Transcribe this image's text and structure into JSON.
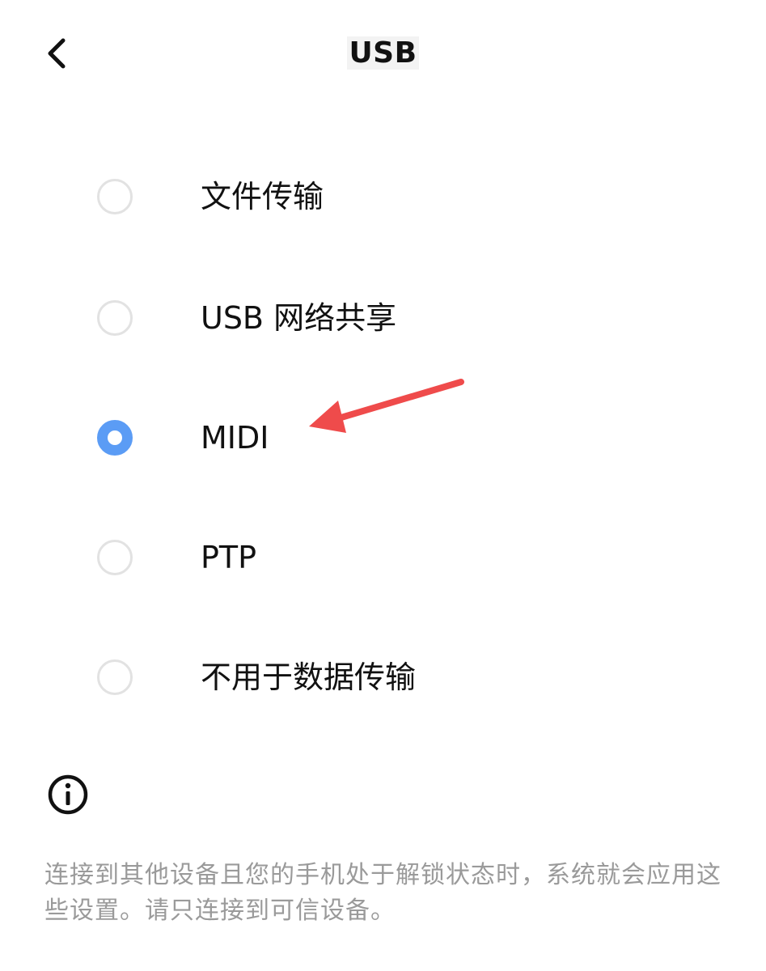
{
  "header": {
    "title": "USB",
    "back_icon": "chevron-left-icon"
  },
  "options": [
    {
      "label": "文件传输",
      "selected": false
    },
    {
      "label": "USB 网络共享",
      "selected": false
    },
    {
      "label": "MIDI",
      "selected": true
    },
    {
      "label": "PTP",
      "selected": false
    },
    {
      "label": "不用于数据传输",
      "selected": false
    }
  ],
  "info": {
    "icon": "info-icon",
    "text": "连接到其他设备且您的手机处于解锁状态时，系统就会应用这些设置。请只连接到可信设备。"
  },
  "colors": {
    "accent": "#5b9cf5",
    "annotation_arrow": "#ef4b4b",
    "radio_unchecked_border": "#e2e2e2",
    "footer_text": "#9a9a9a"
  }
}
